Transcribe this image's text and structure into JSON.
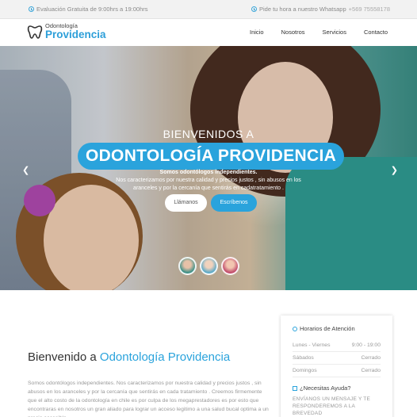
{
  "topbar": {
    "left_text": "Evaluación Gratuita de 9:00hrs a 19:00hrs",
    "right_text": "Pide tu hora a nuestro Whatsapp",
    "phone": "+569 75558178"
  },
  "header": {
    "logo_small": "Odontología",
    "logo_big": "Providencia",
    "nav": [
      "Inicio",
      "Nosotros",
      "Servicios",
      "Contacto"
    ]
  },
  "hero": {
    "welcome": "BIENVENIDOS A",
    "title": "ODONTOLOGÍA PROVIDENCIA",
    "subtitle_line1": "Somos odontólogos independientes.",
    "subtitle_line2": "Nos caracterizamos por nuestra calidad y precios justos , sin abusos en los aranceles y por la cercanía que sentirás en cadatratamiento .",
    "button_call": "Llámanos",
    "button_write": "Escríbenos"
  },
  "content": {
    "heading_prefix": "Bienvenido a",
    "heading_brand": "Odontología Providencia",
    "paragraph": "Somos odontólogos independientes. Nos caracterizamos por nuestra calidad y precios justos , sin abusos en los aranceles y por la cercanía que sentirás en cada tratamiento . Creemos firmemente que el alto costo de la odontología en chile es por culpa de los megaprestadores es por esto que encontraras en nosotros un gran aliado para lograr un acceso legitimo a una salud bucal optima a un precio accesible."
  },
  "sidebar": {
    "hours_title": "Horarios de Atención",
    "rows": [
      {
        "day": "Lunes - Viernes",
        "time": "9:00 - 19:00"
      },
      {
        "day": "Sábados",
        "time": "Cerrado"
      },
      {
        "day": "Domingos",
        "time": "Cerrado"
      }
    ],
    "help_title": "¿Necesitas Ayuda?",
    "help_text": "ENVÍANOS UN MENSAJE Y TE RESPONDEREMOS A LA BREVEDAD"
  },
  "colors": {
    "accent": "#2aa3dc",
    "topbar_bg": "#f2f2f2"
  },
  "icons": [
    "clock-icon",
    "whatsapp-icon",
    "tooth-logo-icon",
    "chevron-left-icon",
    "chevron-right-icon",
    "edit-icon"
  ]
}
